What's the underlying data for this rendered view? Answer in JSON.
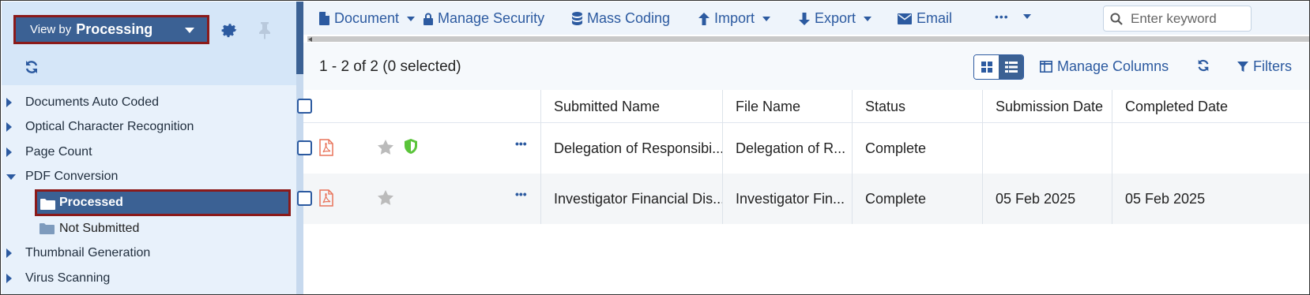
{
  "sidebar": {
    "view_by_prefix": "View by",
    "view_by_value": "Processing",
    "tree": [
      {
        "label": "Documents Auto Coded",
        "expanded": false
      },
      {
        "label": "Optical Character Recognition",
        "expanded": false
      },
      {
        "label": "Page Count",
        "expanded": false
      },
      {
        "label": "PDF Conversion",
        "expanded": true
      },
      {
        "label": "Thumbnail Generation",
        "expanded": false
      },
      {
        "label": "Virus Scanning",
        "expanded": false
      }
    ],
    "children": [
      {
        "label": "Processed",
        "selected": true
      },
      {
        "label": "Not Submitted",
        "selected": false
      }
    ]
  },
  "toolbar": {
    "document": "Document",
    "manage_security": "Manage Security",
    "mass_coding": "Mass Coding",
    "import": "Import",
    "export": "Export",
    "email": "Email",
    "more": "•••",
    "search_placeholder": "Enter keyword",
    "truncated_item": "Do"
  },
  "subbar": {
    "count": "1 - 2 of 2 (0 selected)",
    "manage_columns": "Manage Columns",
    "filters": "Filters"
  },
  "table": {
    "columns": [
      "Submitted Name",
      "File Name",
      "Status",
      "Submission Date",
      "Completed Date"
    ],
    "rows": [
      {
        "submitted_name": "Delegation of Responsibi...",
        "file_name": "Delegation of R...",
        "status": "Complete",
        "submission_date": "",
        "completed_date": "",
        "has_shield": true
      },
      {
        "submitted_name": "Investigator Financial Dis...",
        "file_name": "Investigator Fin...",
        "status": "Complete",
        "submission_date": "05 Feb 2025",
        "completed_date": "05 Feb 2025",
        "has_shield": false
      }
    ]
  },
  "colors": {
    "primary": "#3b6194",
    "accent": "#2c5aa0",
    "highlight_border": "#8b1a1a",
    "pdf_icon": "#e8735a",
    "shield": "#5ac43a",
    "star": "#bbbbbb"
  }
}
